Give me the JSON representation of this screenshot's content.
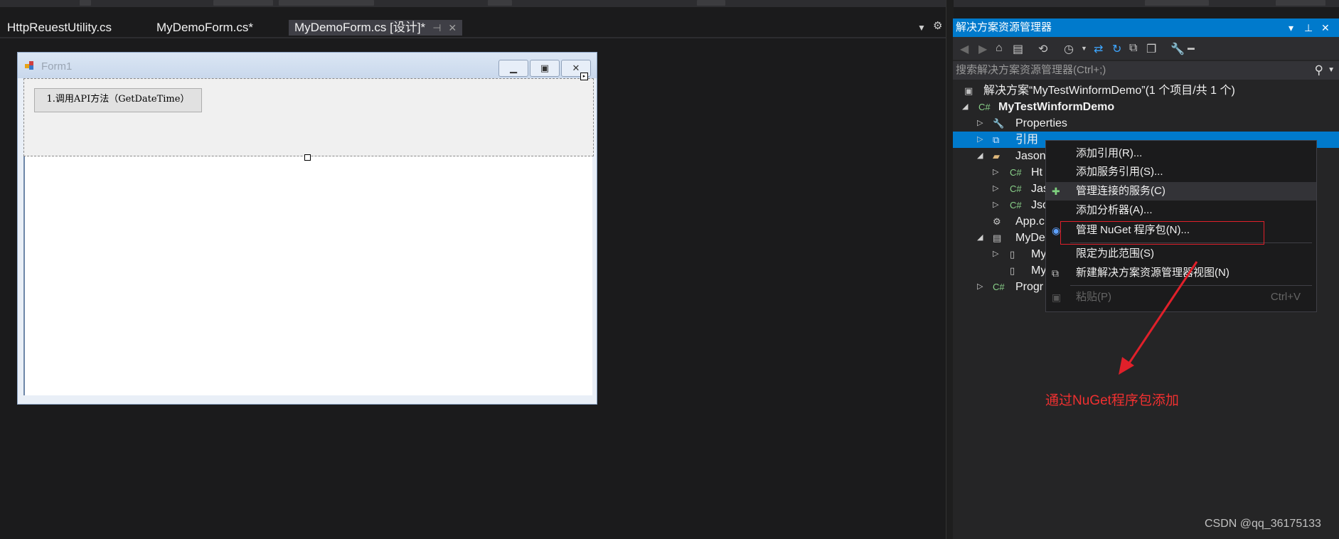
{
  "editor": {
    "tabs": [
      {
        "label": "HttpReuestUtility.cs"
      },
      {
        "label": "MyDemoForm.cs*"
      },
      {
        "label": "MyDemoForm.cs [设计]*",
        "pin": "⊣",
        "close": "✕"
      }
    ]
  },
  "designer": {
    "form_title": "Form1",
    "button_label": "1.调用API方法（GetDateTime）"
  },
  "solution_explorer": {
    "title": "解决方案资源管理器",
    "search_placeholder": "搜索解决方案资源管理器(Ctrl+;)",
    "tree": [
      {
        "label": "解决方案“MyTestWinformDemo”(1 个项目/共 1 个)"
      },
      {
        "label": "MyTestWinformDemo"
      },
      {
        "label": "Properties"
      },
      {
        "label": "引用"
      },
      {
        "label": "Jason"
      },
      {
        "label": "Ht"
      },
      {
        "label": "Jas"
      },
      {
        "label": "Jso"
      },
      {
        "label": "App.c"
      },
      {
        "label": "MyDe"
      },
      {
        "label": "My"
      },
      {
        "label": "My"
      },
      {
        "label": "Progr"
      }
    ]
  },
  "context_menu": {
    "items": [
      {
        "label": "添加引用(R)..."
      },
      {
        "label": "添加服务引用(S)..."
      },
      {
        "label": "管理连接的服务(C)"
      },
      {
        "label": "添加分析器(A)..."
      },
      {
        "label": "管理 NuGet 程序包(N)..."
      },
      {
        "label": "限定为此范围(S)"
      },
      {
        "label": "新建解决方案资源管理器视图(N)"
      },
      {
        "label": "粘贴(P)",
        "shortcut": "Ctrl+V"
      }
    ]
  },
  "annotation": "通过NuGet程序包添加",
  "watermark": "CSDN @qq_36175133",
  "colors": {
    "accent": "#007acc",
    "annotation_red": "#e0202a"
  }
}
